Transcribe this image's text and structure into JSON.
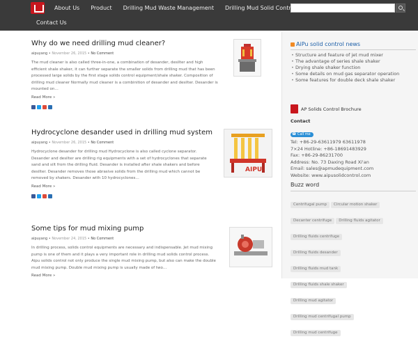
{
  "header": {
    "nav": [
      "About Us",
      "Product",
      "Drilling Mud Waste Management",
      "Drilling Mud Solid Control"
    ],
    "nav2": "Contact Us",
    "search_placeholder": ""
  },
  "posts": [
    {
      "title": "Why do we need drilling mud cleaner?",
      "author": "aipuyang",
      "date": "November 26, 2015",
      "comments": "No Comment",
      "excerpt": "The mud cleaner is also called three-in-one, a combination of desander, desilter and high efficient shale shaker, it can further separate the smaller solids from drilling mud that has been processed large solids by the first stage solids control equipment/shale shaker. Composition of drilling mud cleaner Normally mud cleaner is a combinition of desander and desilter. Desander is mounted on…",
      "read_more": "Read More »"
    },
    {
      "title": "Hydrocyclone desander used in drilling mud system",
      "author": "aipuyang",
      "date": "November 26, 2015",
      "comments": "No Comment",
      "excerpt": "Hydrocyclone desander for drilling mud Hydrocyclone is also called cyclone separator. Desander and desilter are drilling rig equipments with a set of hydrocyclones that separate sand and silt from the drilling fluid. Desander is installed after shale shakers and before desilter. Desander removes those abrasive solids from the drilling mud which cannot be removed by shakers. Desander with 10 hydrocyclones…",
      "read_more": "Read More »",
      "image_text": "AIPU"
    },
    {
      "title": "Some tips for mud mixing pump",
      "author": "aipuyang",
      "date": "November 24, 2015",
      "comments": "No Comment",
      "excerpt": "In drilling process, solids control equipments are necessary and indispensable. Jet mud mixing pump is one of them and it plays a very important role in drilling mud solids control process. Aipu solids control not only produce the single mud mixing pump, but also can make the double mud mixing pump. Double mud mixing pump is usually made of two…",
      "read_more": "Read More »"
    }
  ],
  "sidebar": {
    "news_title": "AiPu solid control news",
    "news_items": [
      "Structure and feature of jet mud mixer",
      "The advantage of series shale shaker",
      "Drying shale shaker function",
      "Some details on mud gas separator operation",
      "Some features for double deck shale shaker"
    ],
    "brochure": "AP Solids Control Brochure",
    "contact_label": "Contact",
    "call_badge": "Call me",
    "contact_lines": [
      "Tel: +86-29-63611979 63611978",
      "7×24 Hotline: +86-18691483929",
      "Fax: +86-29-86231700",
      "Address: No. 73 Daxing Road Xi'an",
      "Email: sales@apmudequipment.com",
      "Website: www.aipusolidcontrol.com"
    ],
    "buzz_title": "Buzz word",
    "tags": [
      "Centrifugal pump",
      "Circular motion shaker",
      "Decanter centrifuge",
      "Drilling fluids agitator",
      "Drilling fluids centrifuge",
      "Drilling fluids desander",
      "Drilling fluids mud tank",
      "Drilling fluids shale shaker",
      "Drilling mud agitator",
      "Drilling mud centrifugal pump",
      "Drilling mud centrifuge"
    ]
  },
  "colors": {
    "header_bg": "#3a3a3a",
    "brand_red": "#c8161d"
  }
}
